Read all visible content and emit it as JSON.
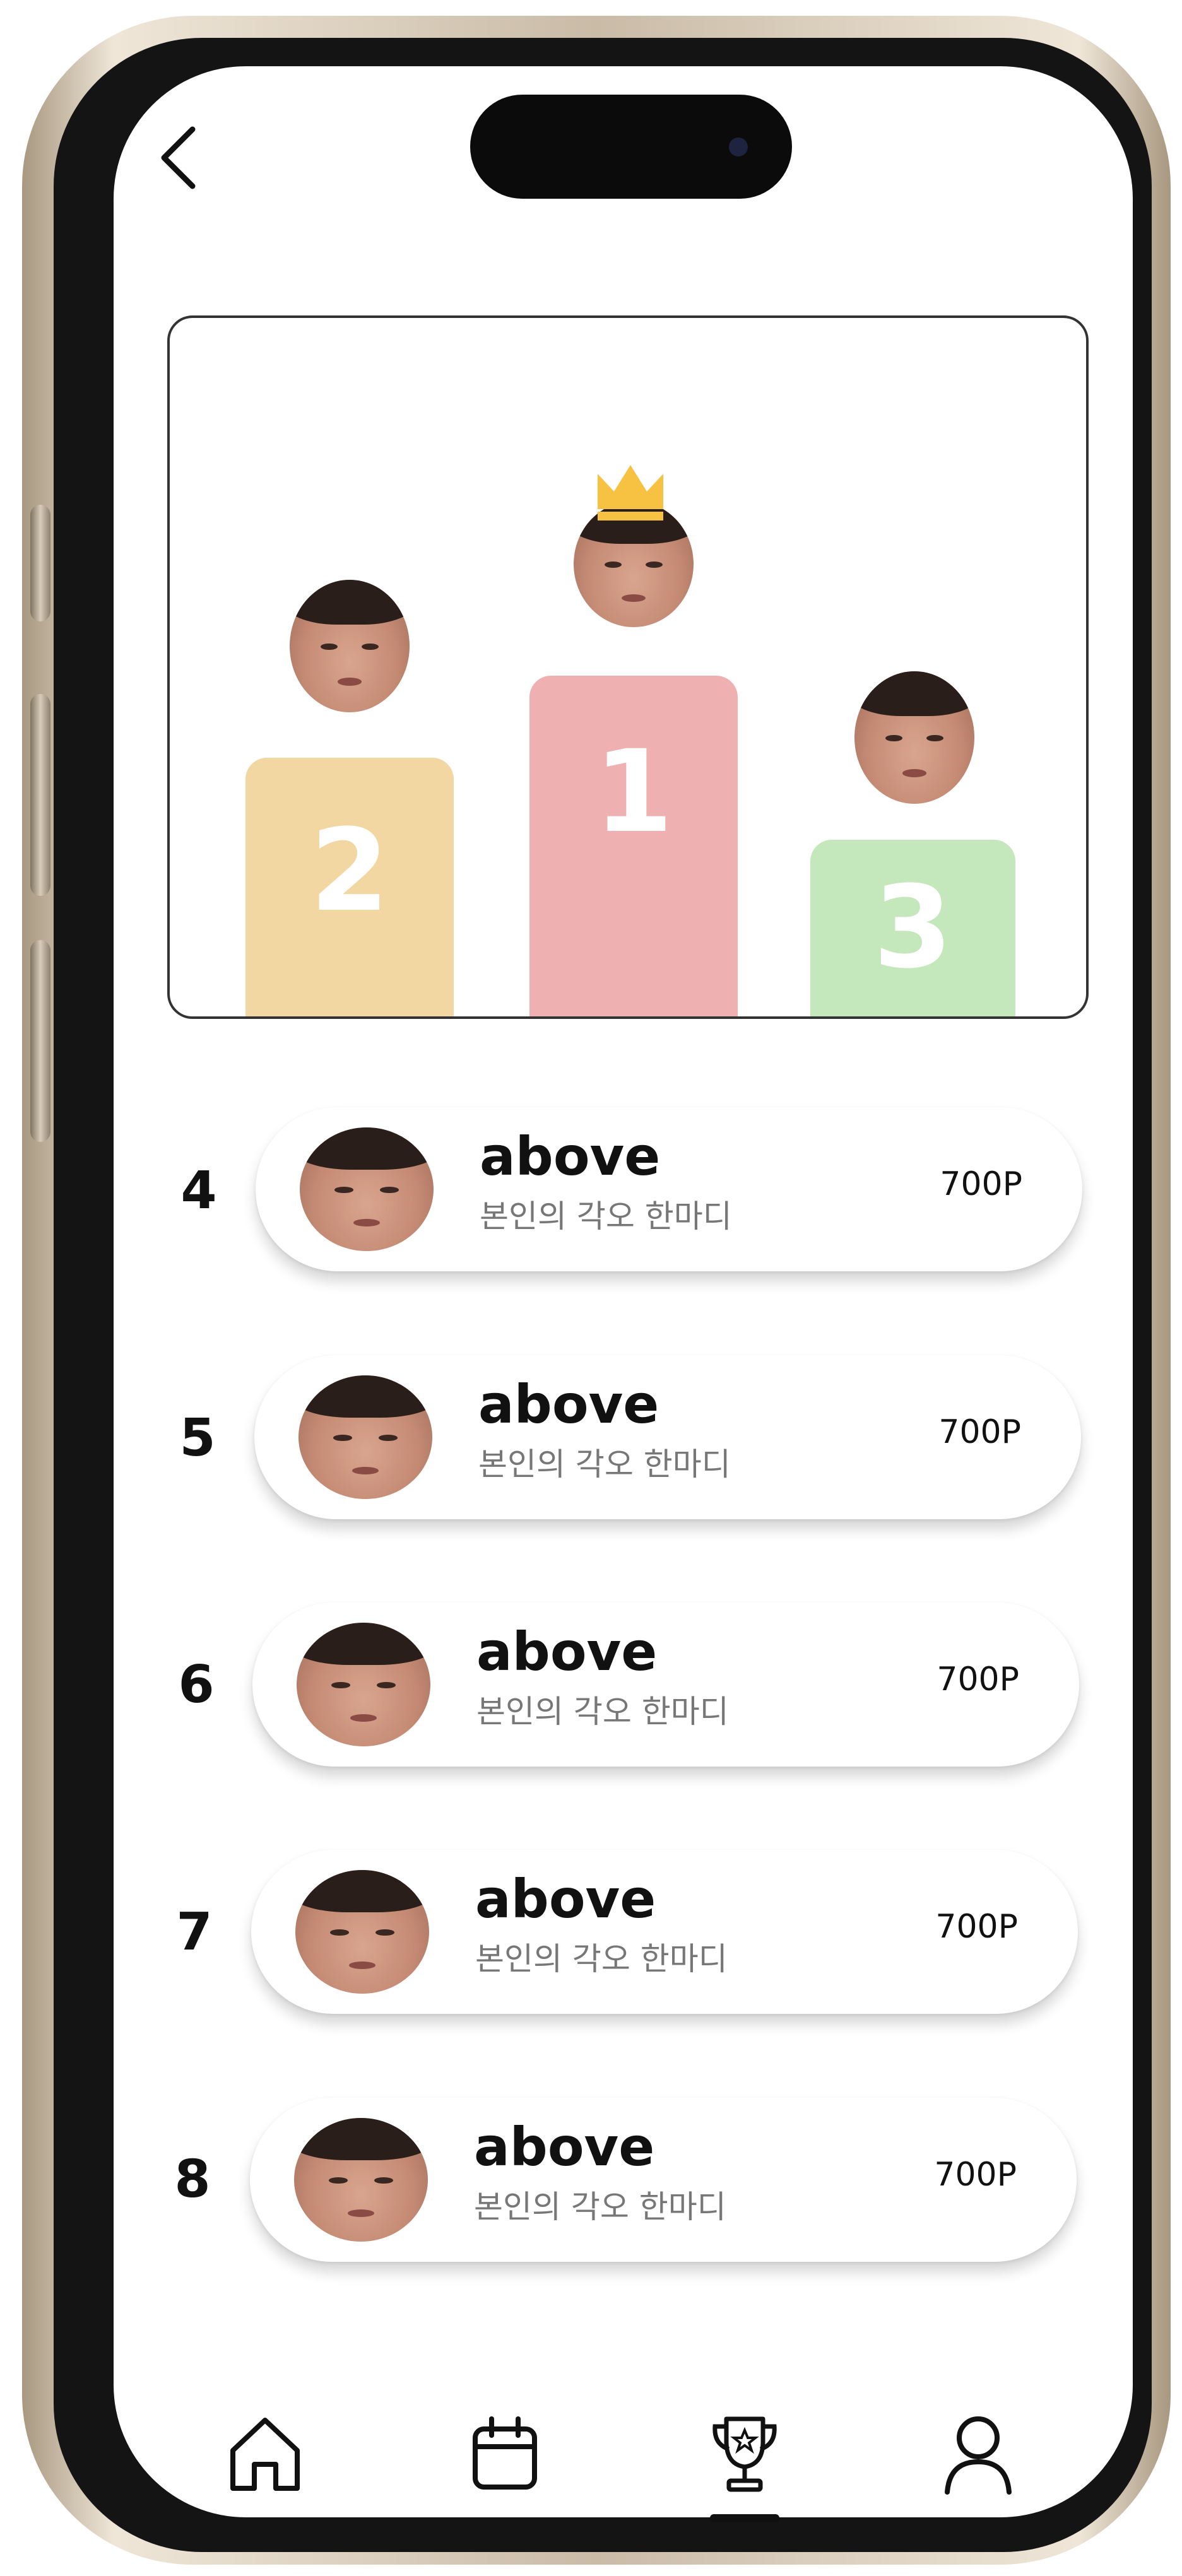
{
  "podium": {
    "first": {
      "rank": "1",
      "color": "#eeb0b0"
    },
    "second": {
      "rank": "2",
      "color": "#f3d7a2"
    },
    "third": {
      "rank": "3",
      "color": "#c5e7bc"
    },
    "crown_color": "#f7c141"
  },
  "ranking": [
    {
      "rank": "4",
      "name": "above",
      "motto": "본인의 각오 한마디",
      "points": "700P"
    },
    {
      "rank": "5",
      "name": "above",
      "motto": "본인의 각오 한마디",
      "points": "700P"
    },
    {
      "rank": "6",
      "name": "above",
      "motto": "본인의 각오 한마디",
      "points": "700P"
    },
    {
      "rank": "7",
      "name": "above",
      "motto": "본인의 각오 한마디",
      "points": "700P"
    },
    {
      "rank": "8",
      "name": "above",
      "motto": "본인의 각오 한마디",
      "points": "700P"
    }
  ],
  "tab_bar": {
    "items": [
      {
        "icon": "home-icon"
      },
      {
        "icon": "calendar-icon"
      },
      {
        "icon": "trophy-icon",
        "active": true
      },
      {
        "icon": "profile-icon"
      }
    ]
  }
}
